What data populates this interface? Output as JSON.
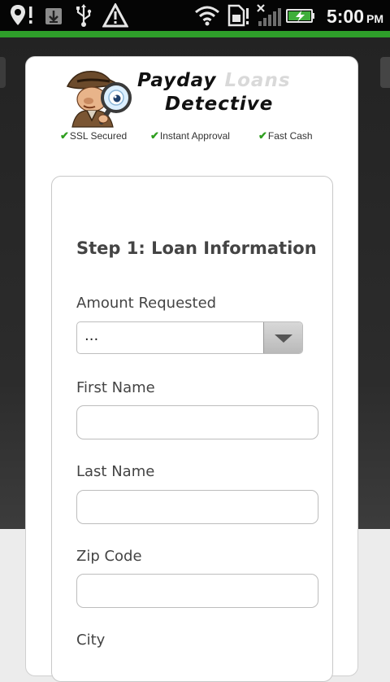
{
  "status_bar": {
    "icons": [
      "location-icon",
      "download-icon",
      "usb-icon",
      "warning-icon",
      "wifi-icon",
      "sim-icon",
      "signal-icon",
      "battery-charging-icon"
    ],
    "time": "5:00",
    "ampm": "PM"
  },
  "colors": {
    "accent_green": "#2e9e2a",
    "check_green": "#2f9e1f",
    "text_gray": "#444444"
  },
  "logo": {
    "word1": "Payday",
    "word2": "Loans",
    "word3": "Detective"
  },
  "badges": [
    {
      "label": "SSL Secured"
    },
    {
      "label": "Instant Approval"
    },
    {
      "label": "Fast Cash"
    }
  ],
  "form": {
    "step_title": "Step 1: Loan Information",
    "amount_label": "Amount Requested",
    "amount_value": "...",
    "first_name_label": "First Name",
    "first_name_value": "",
    "last_name_label": "Last Name",
    "last_name_value": "",
    "zip_label": "Zip Code",
    "zip_value": "",
    "city_label": "City"
  }
}
